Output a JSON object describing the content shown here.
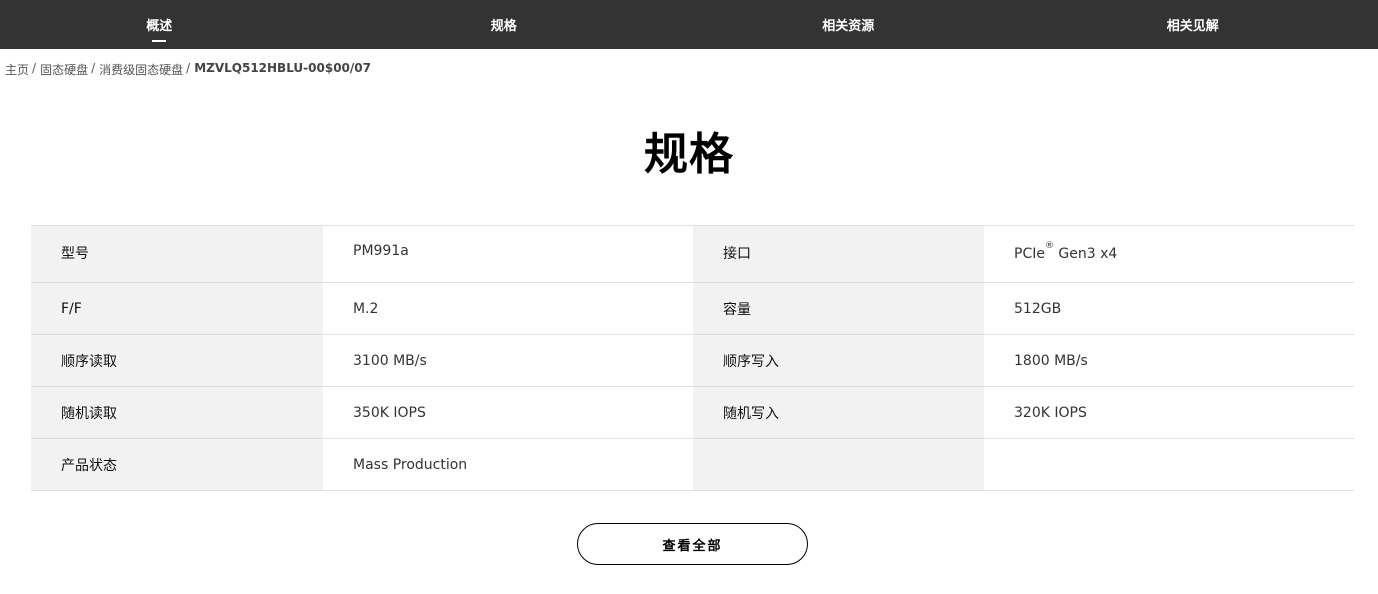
{
  "nav": {
    "items": [
      {
        "label": "概述",
        "active": true
      },
      {
        "label": "规格",
        "active": false
      },
      {
        "label": "相关资源",
        "active": false
      },
      {
        "label": "相关见解",
        "active": false
      }
    ]
  },
  "breadcrumb": {
    "items": [
      "主页",
      "固态硬盘",
      "消费级固态硬盘"
    ],
    "separator": "/",
    "current": "MZVLQ512HBLU-00$00/07"
  },
  "page": {
    "title": "规格"
  },
  "specs": {
    "rows": [
      {
        "k1": "型号",
        "v1": "PM991a",
        "k2": "接口",
        "v2_pre": "PCIe",
        "v2_sup": "®",
        "v2_post": " Gen3 x4"
      },
      {
        "k1": "F/F",
        "v1": "M.2",
        "k2": "容量",
        "v2": "512GB"
      },
      {
        "k1": "顺序读取",
        "v1": "3100 MB/s",
        "k2": "顺序写入",
        "v2": "1800 MB/s"
      },
      {
        "k1": "随机读取",
        "v1": "350K IOPS",
        "k2": "随机写入",
        "v2": "320K IOPS"
      },
      {
        "k1": "产品状态",
        "v1": "Mass Production",
        "k2": "",
        "v2": ""
      }
    ]
  },
  "actions": {
    "view_all_label": "查看全部"
  },
  "colors": {
    "nav_bg": "#333333",
    "key_cell_bg": "#f2f2f2",
    "border": "#dddddd"
  }
}
